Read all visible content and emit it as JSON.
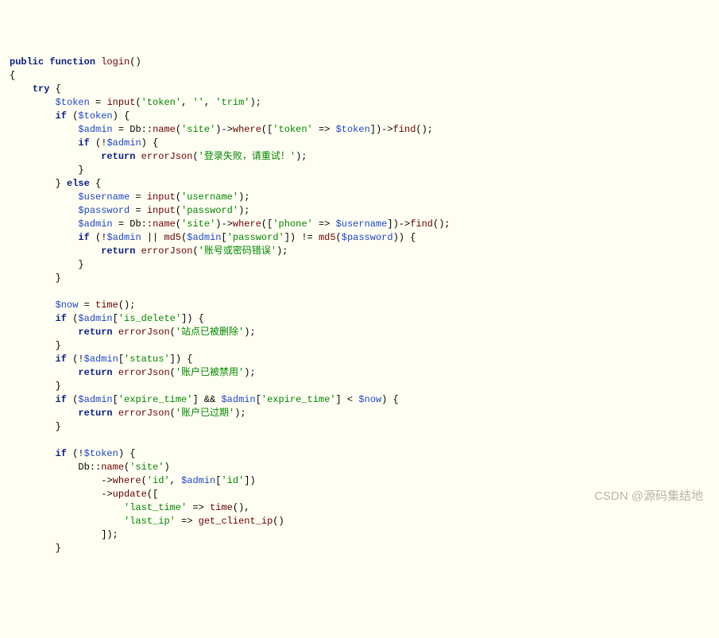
{
  "watermark": "CSDN @源码集结地",
  "code": {
    "tokens": [
      [
        "k",
        "public"
      ],
      [
        "p",
        " "
      ],
      [
        "k",
        "function"
      ],
      [
        "p",
        " "
      ],
      [
        "f",
        "login"
      ],
      [
        "p",
        "()"
      ],
      [
        "nl"
      ],
      [
        "p",
        "{"
      ],
      [
        "nl"
      ],
      [
        "p",
        "    "
      ],
      [
        "k",
        "try"
      ],
      [
        "p",
        " {"
      ],
      [
        "nl"
      ],
      [
        "p",
        "        "
      ],
      [
        "v",
        "$token"
      ],
      [
        "p",
        " = "
      ],
      [
        "f",
        "input"
      ],
      [
        "p",
        "("
      ],
      [
        "s",
        "'token'"
      ],
      [
        "p",
        ", "
      ],
      [
        "s",
        "''"
      ],
      [
        "p",
        ", "
      ],
      [
        "s",
        "'trim'"
      ],
      [
        "p",
        ");"
      ],
      [
        "nl"
      ],
      [
        "p",
        "        "
      ],
      [
        "k",
        "if"
      ],
      [
        "p",
        " ("
      ],
      [
        "v",
        "$token"
      ],
      [
        "p",
        ") {"
      ],
      [
        "nl"
      ],
      [
        "p",
        "            "
      ],
      [
        "v",
        "$admin"
      ],
      [
        "p",
        " = Db::"
      ],
      [
        "f",
        "name"
      ],
      [
        "p",
        "("
      ],
      [
        "s",
        "'site'"
      ],
      [
        "p",
        ")->"
      ],
      [
        "f",
        "where"
      ],
      [
        "p",
        "(["
      ],
      [
        "s",
        "'token'"
      ],
      [
        "p",
        " => "
      ],
      [
        "v",
        "$token"
      ],
      [
        "p",
        "])->"
      ],
      [
        "f",
        "find"
      ],
      [
        "p",
        "();"
      ],
      [
        "nl"
      ],
      [
        "p",
        "            "
      ],
      [
        "k",
        "if"
      ],
      [
        "p",
        " (!"
      ],
      [
        "v",
        "$admin"
      ],
      [
        "p",
        ") {"
      ],
      [
        "nl"
      ],
      [
        "p",
        "                "
      ],
      [
        "r",
        "return"
      ],
      [
        "p",
        " "
      ],
      [
        "f",
        "errorJson"
      ],
      [
        "p",
        "("
      ],
      [
        "s",
        "'登录失败，请重试！'"
      ],
      [
        "p",
        ");"
      ],
      [
        "nl"
      ],
      [
        "p",
        "            }"
      ],
      [
        "nl"
      ],
      [
        "p",
        "        } "
      ],
      [
        "k",
        "else"
      ],
      [
        "p",
        " {"
      ],
      [
        "nl"
      ],
      [
        "p",
        "            "
      ],
      [
        "v",
        "$username"
      ],
      [
        "p",
        " = "
      ],
      [
        "f",
        "input"
      ],
      [
        "p",
        "("
      ],
      [
        "s",
        "'username'"
      ],
      [
        "p",
        ");"
      ],
      [
        "nl"
      ],
      [
        "p",
        "            "
      ],
      [
        "v",
        "$password"
      ],
      [
        "p",
        " = "
      ],
      [
        "f",
        "input"
      ],
      [
        "p",
        "("
      ],
      [
        "s",
        "'password'"
      ],
      [
        "p",
        ");"
      ],
      [
        "nl"
      ],
      [
        "p",
        "            "
      ],
      [
        "v",
        "$admin"
      ],
      [
        "p",
        " = Db::"
      ],
      [
        "f",
        "name"
      ],
      [
        "p",
        "("
      ],
      [
        "s",
        "'site'"
      ],
      [
        "p",
        ")->"
      ],
      [
        "f",
        "where"
      ],
      [
        "p",
        "(["
      ],
      [
        "s",
        "'phone'"
      ],
      [
        "p",
        " => "
      ],
      [
        "v",
        "$username"
      ],
      [
        "p",
        "])->"
      ],
      [
        "f",
        "find"
      ],
      [
        "p",
        "();"
      ],
      [
        "nl"
      ],
      [
        "p",
        "            "
      ],
      [
        "k",
        "if"
      ],
      [
        "p",
        " (!"
      ],
      [
        "v",
        "$admin"
      ],
      [
        "p",
        " || "
      ],
      [
        "f",
        "md5"
      ],
      [
        "p",
        "("
      ],
      [
        "v",
        "$admin"
      ],
      [
        "p",
        "["
      ],
      [
        "s",
        "'password'"
      ],
      [
        "p",
        "]) != "
      ],
      [
        "f",
        "md5"
      ],
      [
        "p",
        "("
      ],
      [
        "v",
        "$password"
      ],
      [
        "p",
        ")) {"
      ],
      [
        "nl"
      ],
      [
        "p",
        "                "
      ],
      [
        "r",
        "return"
      ],
      [
        "p",
        " "
      ],
      [
        "f",
        "errorJson"
      ],
      [
        "p",
        "("
      ],
      [
        "s",
        "'账号或密码错误'"
      ],
      [
        "p",
        ");"
      ],
      [
        "nl"
      ],
      [
        "p",
        "            }"
      ],
      [
        "nl"
      ],
      [
        "p",
        "        }"
      ],
      [
        "nl"
      ],
      [
        "nl"
      ],
      [
        "p",
        "        "
      ],
      [
        "v",
        "$now"
      ],
      [
        "p",
        " = "
      ],
      [
        "f",
        "time"
      ],
      [
        "p",
        "();"
      ],
      [
        "nl"
      ],
      [
        "p",
        "        "
      ],
      [
        "k",
        "if"
      ],
      [
        "p",
        " ("
      ],
      [
        "v",
        "$admin"
      ],
      [
        "p",
        "["
      ],
      [
        "s",
        "'is_delete'"
      ],
      [
        "p",
        "]) {"
      ],
      [
        "nl"
      ],
      [
        "p",
        "            "
      ],
      [
        "r",
        "return"
      ],
      [
        "p",
        " "
      ],
      [
        "f",
        "errorJson"
      ],
      [
        "p",
        "("
      ],
      [
        "s",
        "'站点已被删除'"
      ],
      [
        "p",
        ");"
      ],
      [
        "nl"
      ],
      [
        "p",
        "        }"
      ],
      [
        "nl"
      ],
      [
        "p",
        "        "
      ],
      [
        "k",
        "if"
      ],
      [
        "p",
        " (!"
      ],
      [
        "v",
        "$admin"
      ],
      [
        "p",
        "["
      ],
      [
        "s",
        "'status'"
      ],
      [
        "p",
        "]) {"
      ],
      [
        "nl"
      ],
      [
        "p",
        "            "
      ],
      [
        "r",
        "return"
      ],
      [
        "p",
        " "
      ],
      [
        "f",
        "errorJson"
      ],
      [
        "p",
        "("
      ],
      [
        "s",
        "'账户已被禁用'"
      ],
      [
        "p",
        ");"
      ],
      [
        "nl"
      ],
      [
        "p",
        "        }"
      ],
      [
        "nl"
      ],
      [
        "p",
        "        "
      ],
      [
        "k",
        "if"
      ],
      [
        "p",
        " ("
      ],
      [
        "v",
        "$admin"
      ],
      [
        "p",
        "["
      ],
      [
        "s",
        "'expire_time'"
      ],
      [
        "p",
        "] && "
      ],
      [
        "v",
        "$admin"
      ],
      [
        "p",
        "["
      ],
      [
        "s",
        "'expire_time'"
      ],
      [
        "p",
        "] < "
      ],
      [
        "v",
        "$now"
      ],
      [
        "p",
        ") {"
      ],
      [
        "nl"
      ],
      [
        "p",
        "            "
      ],
      [
        "r",
        "return"
      ],
      [
        "p",
        " "
      ],
      [
        "f",
        "errorJson"
      ],
      [
        "p",
        "("
      ],
      [
        "s",
        "'账户已过期'"
      ],
      [
        "p",
        ");"
      ],
      [
        "nl"
      ],
      [
        "p",
        "        }"
      ],
      [
        "nl"
      ],
      [
        "nl"
      ],
      [
        "p",
        "        "
      ],
      [
        "k",
        "if"
      ],
      [
        "p",
        " (!"
      ],
      [
        "v",
        "$token"
      ],
      [
        "p",
        ") {"
      ],
      [
        "nl"
      ],
      [
        "p",
        "            Db::"
      ],
      [
        "f",
        "name"
      ],
      [
        "p",
        "("
      ],
      [
        "s",
        "'site'"
      ],
      [
        "p",
        ")"
      ],
      [
        "nl"
      ],
      [
        "p",
        "                ->"
      ],
      [
        "f",
        "where"
      ],
      [
        "p",
        "("
      ],
      [
        "s",
        "'id'"
      ],
      [
        "p",
        ", "
      ],
      [
        "v",
        "$admin"
      ],
      [
        "p",
        "["
      ],
      [
        "s",
        "'id'"
      ],
      [
        "p",
        "])"
      ],
      [
        "nl"
      ],
      [
        "p",
        "                ->"
      ],
      [
        "f",
        "update"
      ],
      [
        "p",
        "(["
      ],
      [
        "nl"
      ],
      [
        "p",
        "                    "
      ],
      [
        "s",
        "'last_time'"
      ],
      [
        "p",
        " => "
      ],
      [
        "f",
        "time"
      ],
      [
        "p",
        "(),"
      ],
      [
        "nl"
      ],
      [
        "p",
        "                    "
      ],
      [
        "s",
        "'last_ip'"
      ],
      [
        "p",
        " => "
      ],
      [
        "f",
        "get_client_ip"
      ],
      [
        "p",
        "()"
      ],
      [
        "nl"
      ],
      [
        "p",
        "                ]);"
      ],
      [
        "nl"
      ],
      [
        "p",
        "        }"
      ]
    ]
  },
  "chart_data": null
}
